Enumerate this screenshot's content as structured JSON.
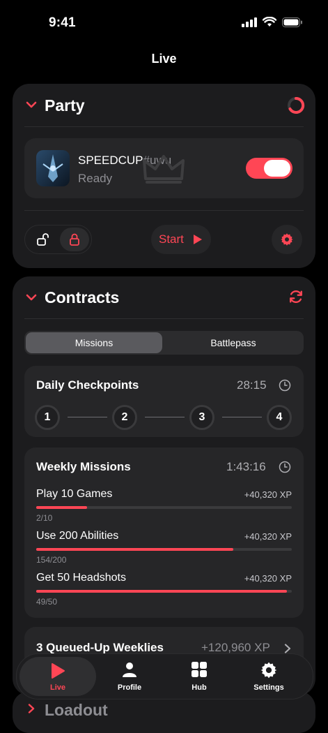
{
  "status": {
    "time": "9:41"
  },
  "nav": {
    "title": "Live"
  },
  "party": {
    "title": "Party",
    "player_name": "SPEEDCUP",
    "player_tag": "#uwu",
    "player_status": "Ready",
    "start_label": "Start"
  },
  "contracts": {
    "title": "Contracts",
    "tabs": [
      "Missions",
      "Battlepass"
    ],
    "daily": {
      "title": "Daily Checkpoints",
      "timer": "28:15",
      "steps": [
        "1",
        "2",
        "3",
        "4"
      ]
    },
    "weekly": {
      "title": "Weekly Missions",
      "timer": "1:43:16",
      "missions": [
        {
          "label": "Play 10 Games",
          "xp": "+40,320 XP",
          "progress": "2/10",
          "fraction": 0.2
        },
        {
          "label": "Use 200 Abilities",
          "xp": "+40,320 XP",
          "progress": "154/200",
          "fraction": 0.77
        },
        {
          "label": "Get 50 Headshots",
          "xp": "+40,320 XP",
          "progress": "49/50",
          "fraction": 0.98
        }
      ]
    },
    "queued": {
      "label": "3 Queued-Up Weeklies",
      "xp": "+120,960 XP"
    }
  },
  "loadout": {
    "title": "Loadout"
  },
  "tabbar": {
    "items": [
      {
        "label": "Live",
        "icon": "play-icon"
      },
      {
        "label": "Profile",
        "icon": "person-icon"
      },
      {
        "label": "Hub",
        "icon": "grid-icon"
      },
      {
        "label": "Settings",
        "icon": "gear-icon"
      }
    ]
  },
  "colors": {
    "accent": "#ff4655",
    "card": "#1c1c1e",
    "background": "#000000"
  }
}
